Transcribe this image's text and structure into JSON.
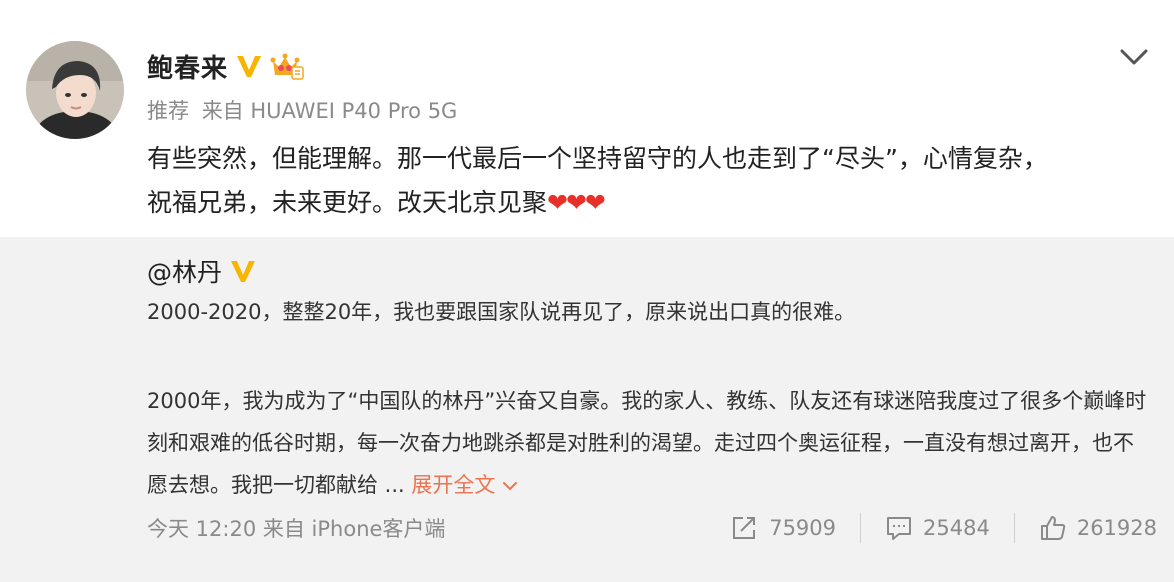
{
  "post": {
    "author": "鲍春来",
    "meta": {
      "recommend": "推荐",
      "source": "来自 HUAWEI P40 Pro 5G"
    },
    "text_line1": "有些突然，但能理解。那一代最后一个坚持留守的人也走到了“尽头”，心情复杂，",
    "text_line2": "祝福兄弟，未来更好。改天北京见聚",
    "hearts": "❤❤❤"
  },
  "repost": {
    "author": "@林丹",
    "paragraph1": "2000-2020，整整20年，我也要跟国家队说再见了，原来说出口真的很难。",
    "paragraph2": "2000年，我为成为了“中国队的林丹”兴奋又自豪。我的家人、教练、队友还有球迷陪我度过了很多个巅峰时刻和艰难的低谷时期，每一次奋力地跳杀都是对胜利的渴望。走过四个奥运征程，一直没有想过离开，也不愿去想。我把一切都献给 ...",
    "expand_label": "展开全文",
    "time": "今天 12:20 来自 iPhone客户端",
    "repost_count": "75909",
    "comment_count": "25484",
    "like_count": "261928"
  },
  "colors": {
    "accent_link": "#eb7350",
    "verified": "#f7b500",
    "repost_bg": "#f2f2f2",
    "heart": "#e8302a"
  },
  "icons": {
    "verified": "verified-v-icon",
    "crown": "crown-badge-icon",
    "menu": "chevron-down-icon",
    "repost": "share-arrow-icon",
    "comment": "comment-icon",
    "like": "thumbs-up-icon"
  }
}
